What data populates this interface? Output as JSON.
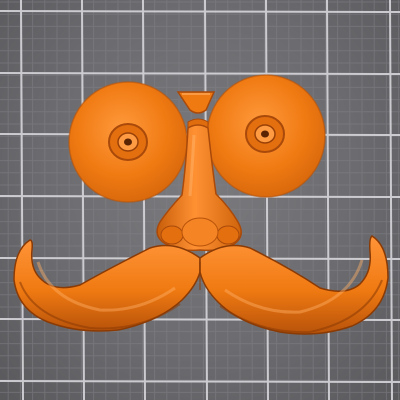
{
  "scene": {
    "object": "mustache-glasses-nose",
    "colors": {
      "background": "#6c6c70",
      "grid_minor": "#808086",
      "grid_major": "#d7d7db",
      "model_main": "#f07a12",
      "model_light": "#ff9a3d",
      "model_shadow": "#b8530a",
      "model_dark": "#8a3a05"
    }
  }
}
